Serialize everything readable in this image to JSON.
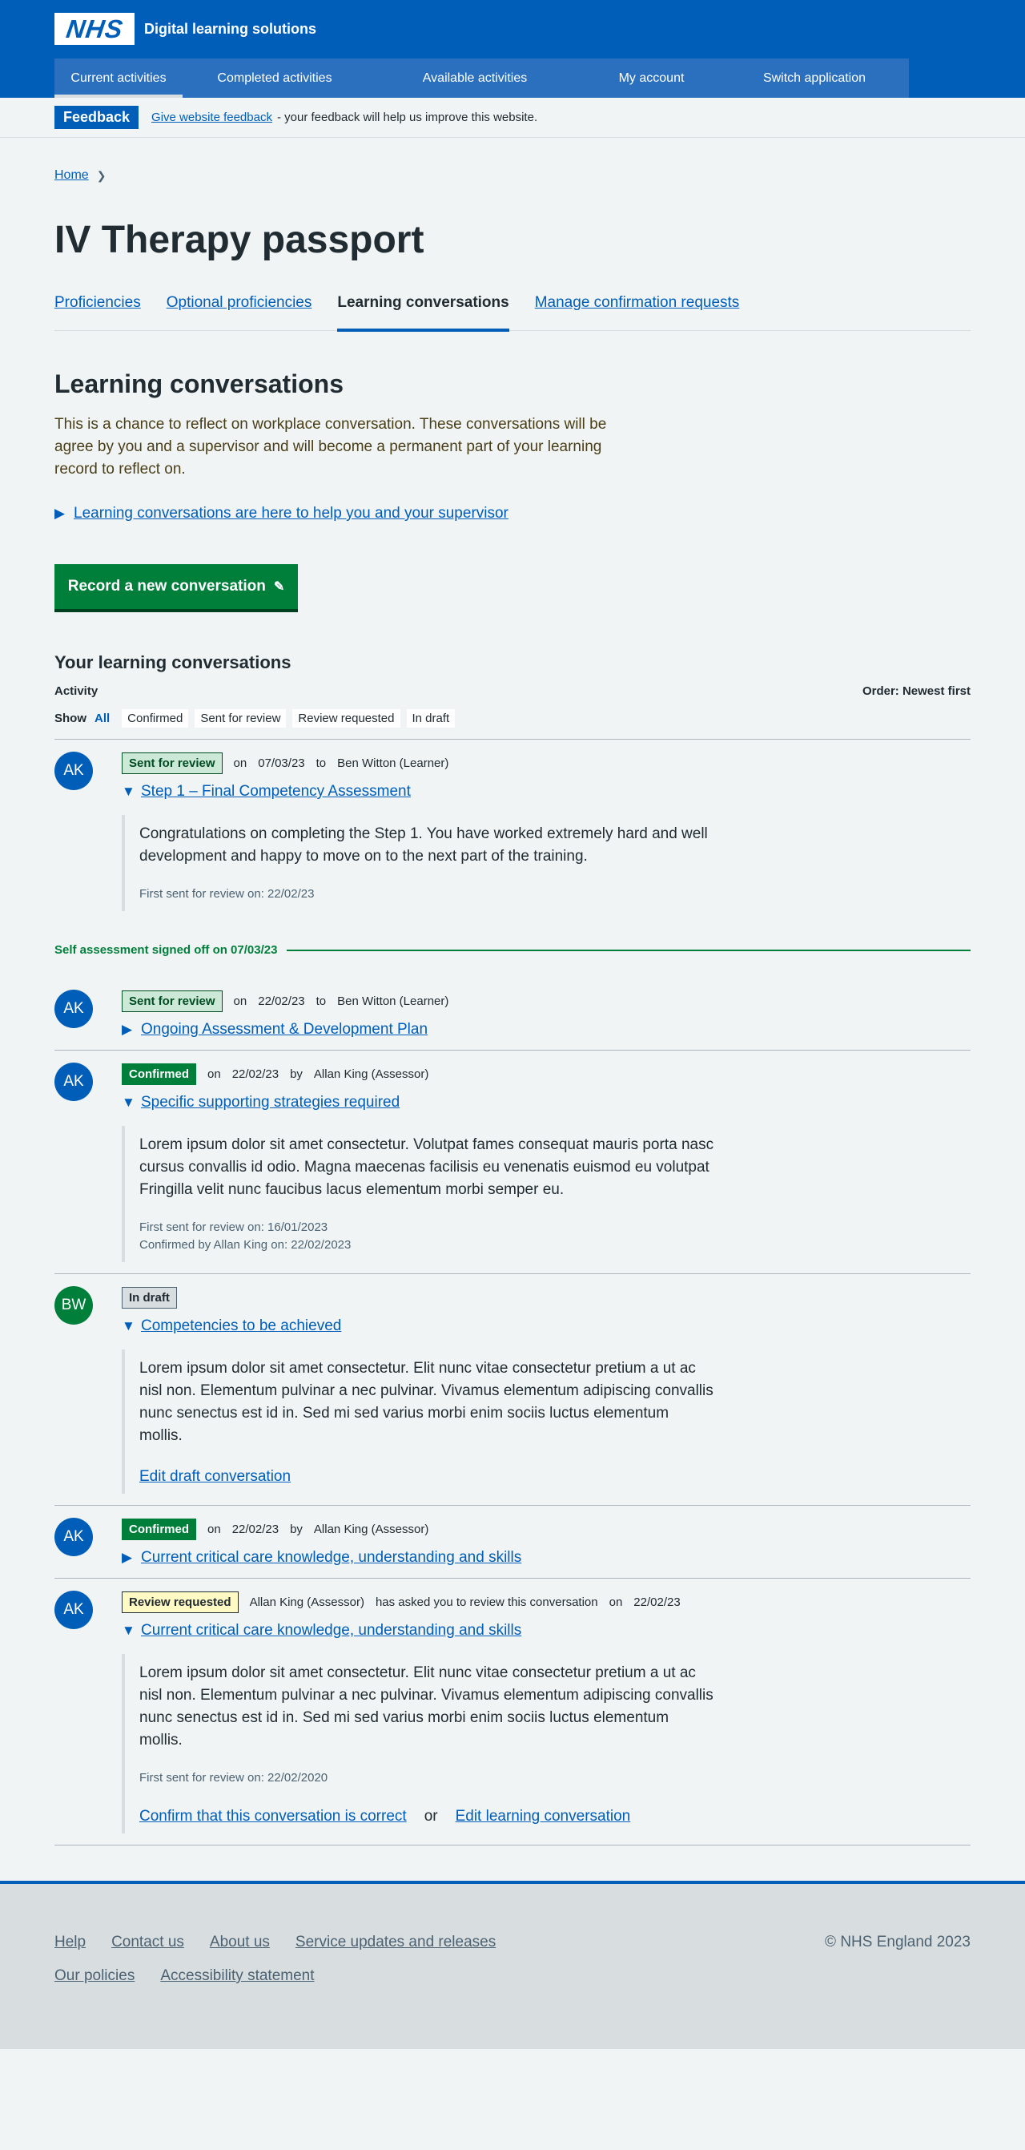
{
  "header": {
    "logo": "NHS",
    "service_name": "Digital learning solutions",
    "nav": [
      "Current activities",
      "Completed activities",
      "Available activities",
      "My account",
      "Switch application"
    ]
  },
  "feedback": {
    "tag": "Feedback",
    "link": "Give website feedback",
    "text": "- your feedback will help us improve this website."
  },
  "breadcrumb": {
    "home": "Home"
  },
  "page_title": "IV Therapy passport",
  "tabs": [
    "Proficiencies",
    "Optional proficiencies",
    "Learning conversations",
    "Manage confirmation requests"
  ],
  "section": {
    "title": "Learning conversations",
    "intro": "This is a chance to reflect on workplace conversation. These conversations will be agree by you and a supervisor and will become a permanent part of your learning record to reflect on.",
    "details_summary": "Learning conversations are here to help you and your supervisor",
    "record_button": "Record a new conversation"
  },
  "list": {
    "title": "Your learning conversations",
    "activity_label": "Activity",
    "order_label": "Order: Newest first",
    "show_label": "Show",
    "filters": [
      "All",
      "Confirmed",
      "Sent for review",
      "Review requested",
      "In draft"
    ]
  },
  "conversations": [
    {
      "initials": "AK",
      "status": "Sent for review",
      "on": "on",
      "date": "07/03/23",
      "rel": "to",
      "person": "Ben Witton (Learner)",
      "title": "Step 1 – Final Competency Assessment",
      "text": "Congratulations on completing the Step 1. You have worked extremely hard and well\ndevelopment and happy to move on to the next part of the training.",
      "first_sent": "First sent for review on: 22/02/23"
    },
    {
      "initials": "AK",
      "status": "Sent for review",
      "on": "on",
      "date": "22/02/23",
      "rel": "to",
      "person": "Ben Witton (Learner)",
      "title": "Ongoing Assessment & Development Plan"
    },
    {
      "initials": "AK",
      "status": "Confirmed",
      "on": "on",
      "date": "22/02/23",
      "rel": "by",
      "person": "Allan King (Assessor)",
      "title": "Specific supporting strategies required",
      "text": "Lorem ipsum dolor sit amet consectetur. Volutpat fames consequat mauris porta nasc\ncursus convallis id odio. Magna maecenas facilisis eu venenatis euismod eu volutpat\nFringilla velit nunc faucibus lacus elementum morbi semper eu.",
      "first_sent": "First sent for review on: 16/01/2023",
      "confirmed_by": "Confirmed by Allan King on: 22/02/2023"
    },
    {
      "initials": "BW",
      "status": "In draft",
      "title": "Competencies to be achieved",
      "text": "Lorem ipsum dolor sit amet consectetur. Elit nunc vitae consectetur pretium a ut ac nisl non. Elementum pulvinar a nec pulvinar. Vivamus elementum adipiscing convallis nunc senectus est id in. Sed mi sed varius morbi enim sociis luctus elementum mollis.",
      "link": "Edit draft conversation"
    },
    {
      "initials": "AK",
      "status": "Confirmed",
      "on": "on",
      "date": "22/02/23",
      "rel": "by",
      "person": "Allan King (Assessor)",
      "title": "Current critical care knowledge, understanding and skills"
    },
    {
      "initials": "AK",
      "status": "Review requested",
      "person": "Allan King (Assessor)",
      "asked": "has asked you to review this conversation",
      "on": "on",
      "date": "22/02/23",
      "title": "Current critical care knowledge, understanding and skills",
      "text": "Lorem ipsum dolor sit amet consectetur. Elit nunc vitae consectetur pretium a ut ac nisl non. Elementum pulvinar a nec pulvinar. Vivamus elementum adipiscing convallis nunc senectus est id in. Sed mi sed varius morbi enim sociis luctus elementum mollis.",
      "first_sent": "First sent for review on: 22/02/2020",
      "confirm_link": "Confirm that this conversation is correct",
      "or": "or",
      "edit_link": "Edit learning conversation"
    }
  ],
  "signoff": "Self assessment signed off on 07/03/23",
  "footer": {
    "links": [
      "Help",
      "Contact us",
      "About us",
      "Service updates and releases",
      "Our policies",
      "Accessibility statement"
    ],
    "copyright": "© NHS England 2023"
  },
  "colors": {
    "nhs_blue": "#005eb8",
    "green": "#007f3b",
    "background": "#f0f4f5"
  },
  "icons": [
    "chevron-right-icon",
    "triangle-right-icon",
    "triangle-down-icon",
    "pencil-icon"
  ]
}
